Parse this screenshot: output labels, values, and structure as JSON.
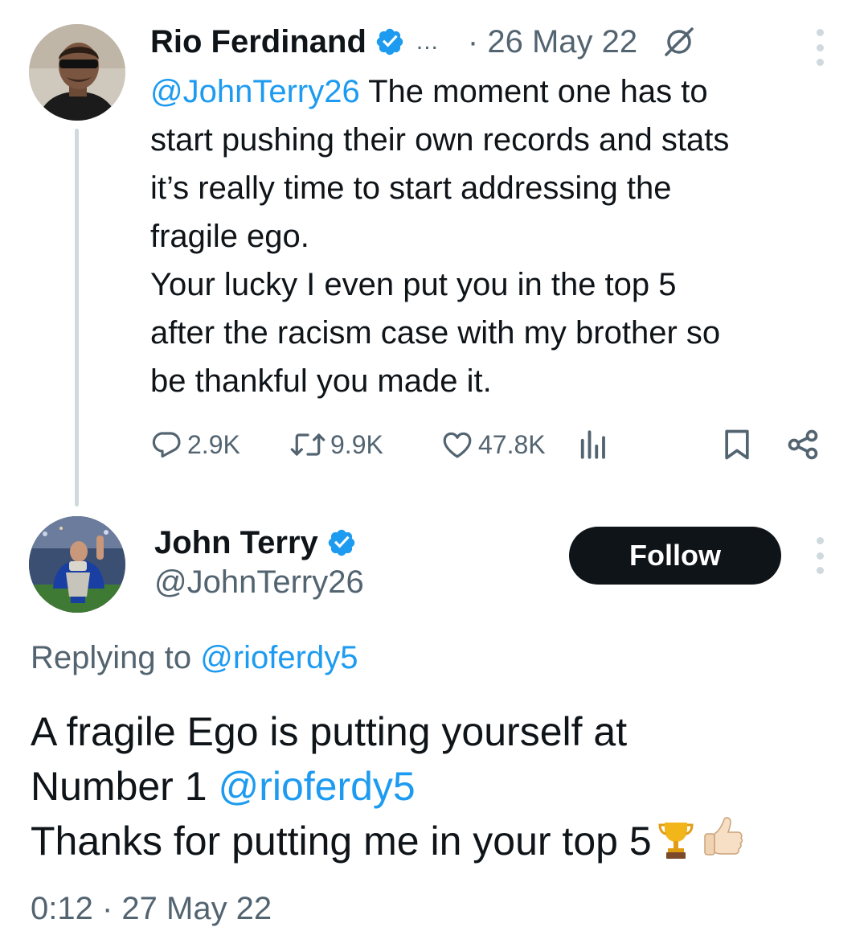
{
  "parent_tweet": {
    "author_name": "Rio Ferdinand",
    "ellipsis": "...",
    "date": "· 26 May 22",
    "text": {
      "mention": "@JohnTerry26",
      "line1_rest": " The moment one has to",
      "line2": "start pushing their own records and stats",
      "line3": "it’s really time to start addressing the",
      "line4": "fragile ego.",
      "line5": "Your lucky I even put you in the top 5",
      "line6": "after the racism case with my brother so",
      "line7": "be thankful you made it."
    },
    "metrics": {
      "replies": "2.9K",
      "reposts": "9.9K",
      "likes": "47.8K"
    }
  },
  "reply_tweet": {
    "author_name": "John Terry",
    "handle": "@JohnTerry26",
    "follow_label": "Follow",
    "replying_prefix": "Replying to ",
    "replying_to": "@rioferdy5",
    "text": {
      "line1": "A fragile Ego is putting yourself at",
      "line2_prefix": "Number 1 ",
      "line2_mention": "@rioferdy5",
      "line3": "Thanks for putting me in your top 5"
    },
    "timestamp": "0:12 · 27 May 22"
  },
  "colors": {
    "accent": "#1d9bf0",
    "text_primary": "#0f1419",
    "text_secondary": "#536471",
    "thread_line": "#cfd9de",
    "follow_button_bg": "#0f1419"
  },
  "icons": [
    "verified-badge-icon",
    "no-interaction-icon",
    "more-icon",
    "reply-icon",
    "repost-icon",
    "like-icon",
    "views-icon",
    "bookmark-icon",
    "share-icon",
    "trophy-emoji",
    "thumbs-up-emoji"
  ]
}
